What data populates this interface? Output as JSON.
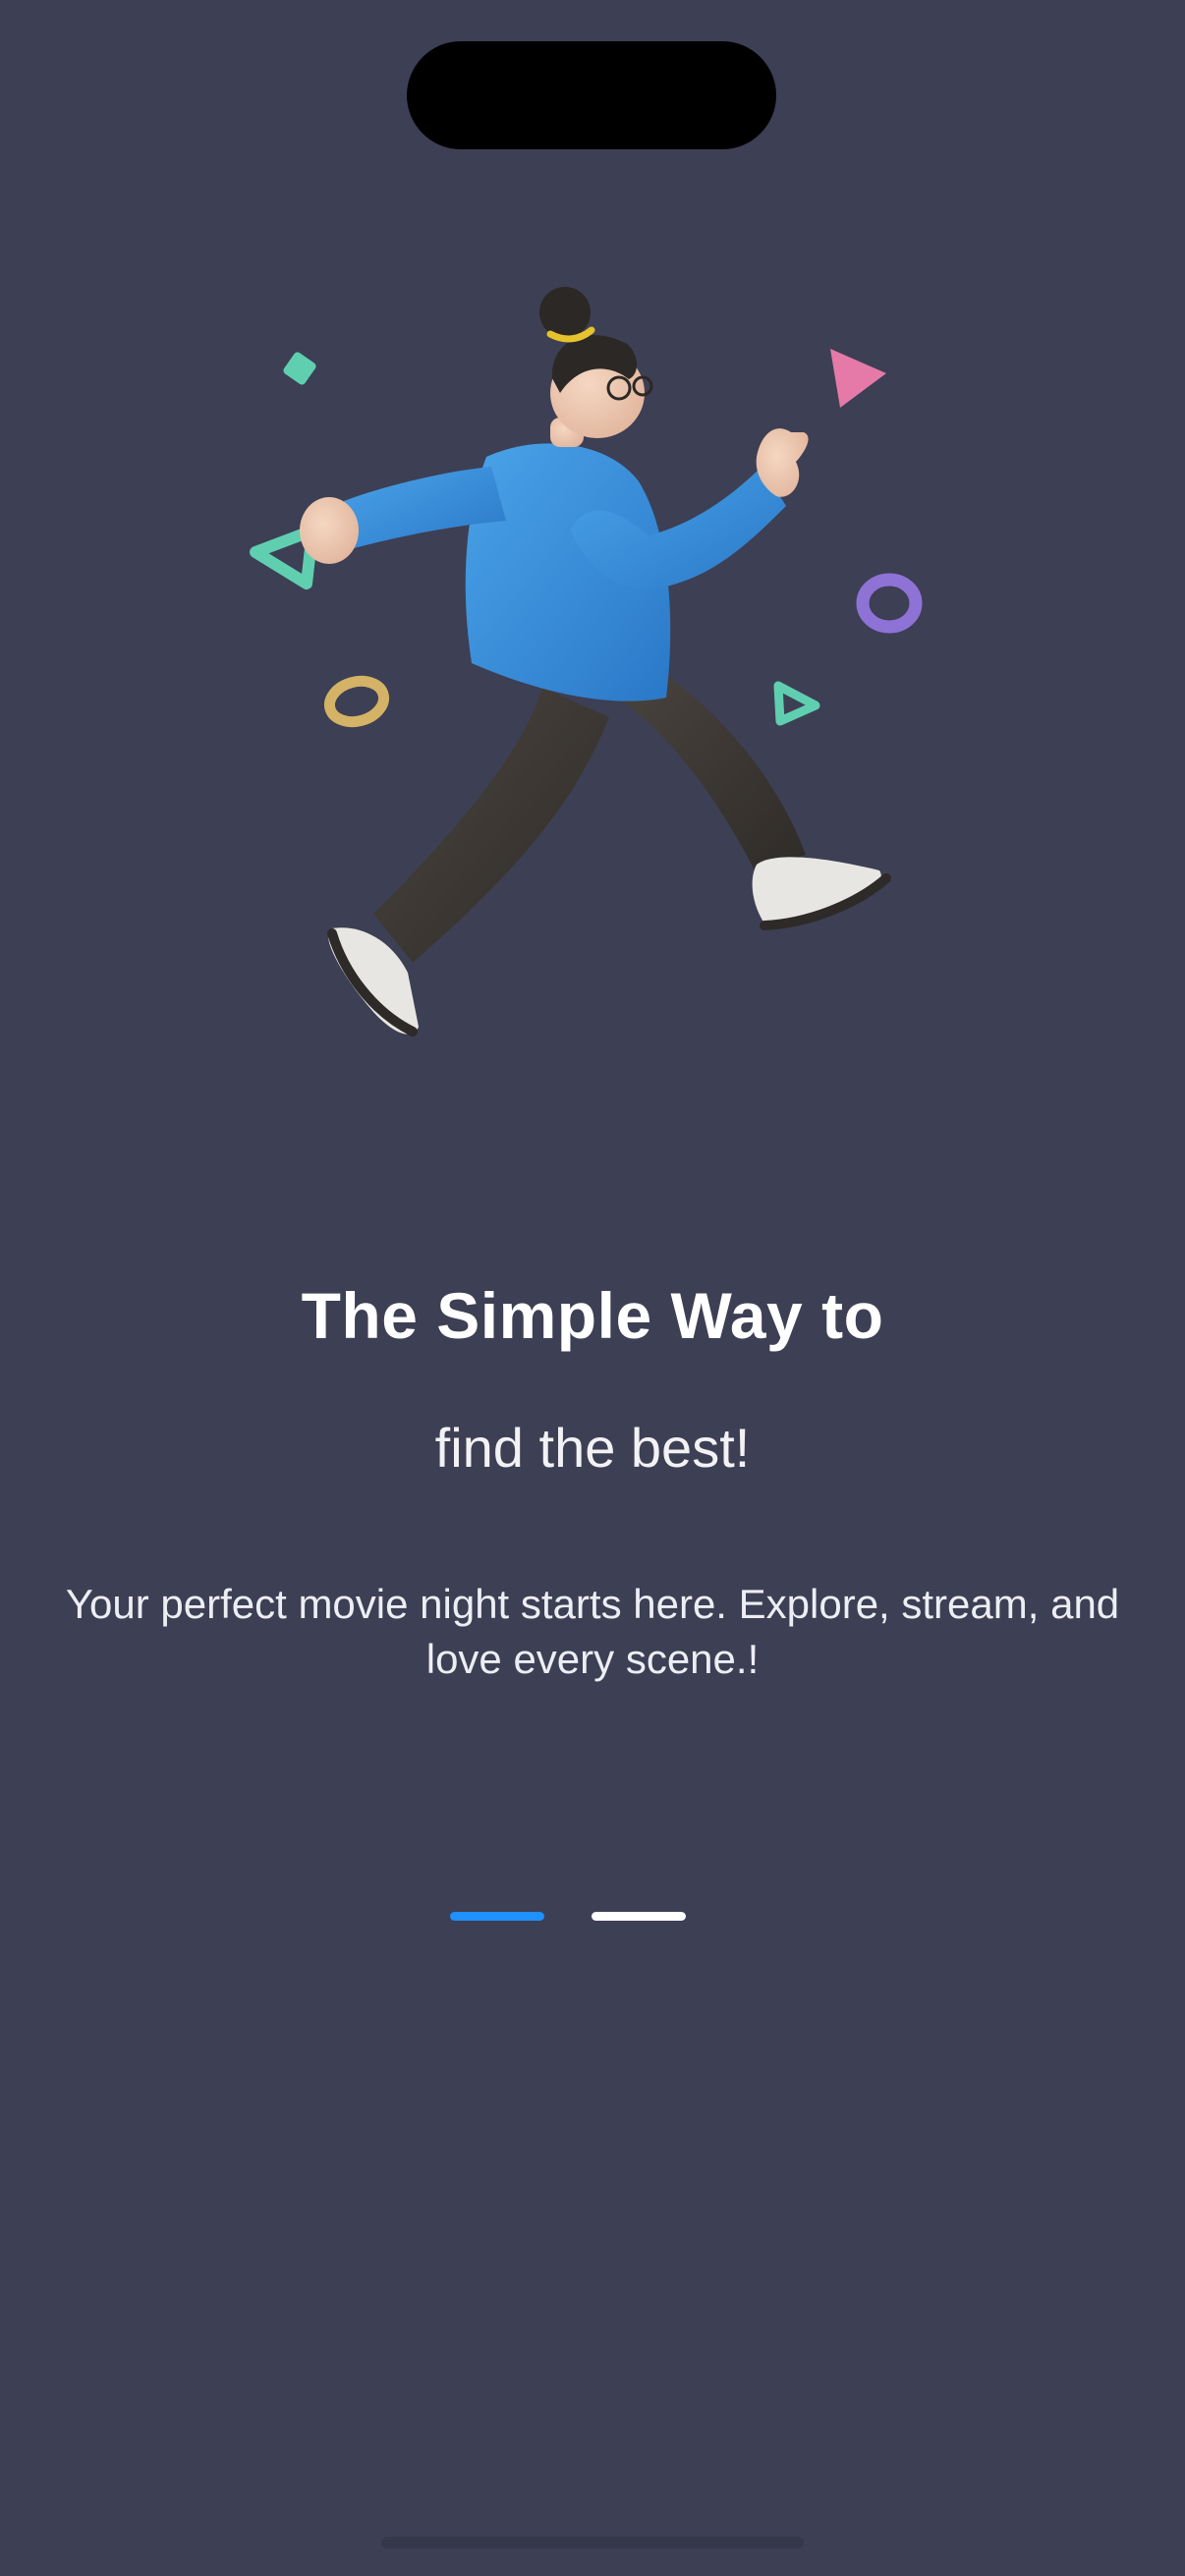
{
  "onboarding": {
    "title": "The Simple Way to",
    "subtitle": "find the best!",
    "description": "Your perfect movie night starts here. Explore, stream, and love every scene.!",
    "illustration_icon": "jumping-person-illustration",
    "page_indicator": {
      "total": 2,
      "active_index": 0,
      "active_color": "#1e90ff",
      "inactive_color": "#ffffff"
    }
  },
  "colors": {
    "background": "#3d3f54",
    "title_text": "#ffffff"
  }
}
